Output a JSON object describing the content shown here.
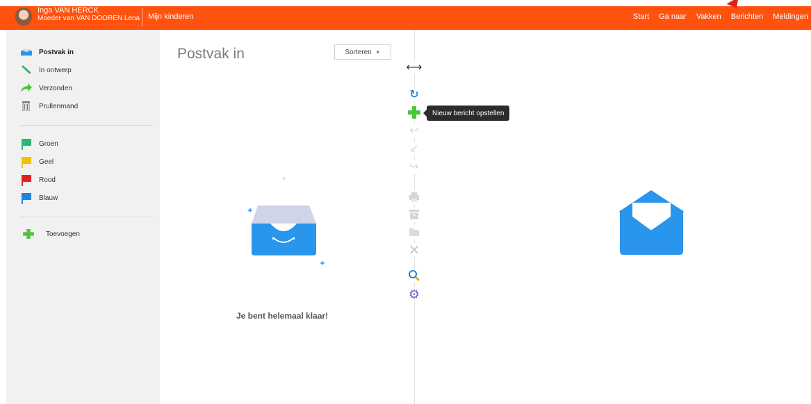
{
  "header": {
    "user_name": "Inga VAN HERCK",
    "user_sub": "Moeder van VAN DOOREN Lena",
    "kids_link": "Mijn kinderen",
    "nav": [
      "Start",
      "Ga naar",
      "Vakken",
      "Berichten",
      "Meldingen"
    ],
    "brand_color": "#ff520e"
  },
  "sidebar": {
    "folders": [
      {
        "label": "Postvak in",
        "icon": "inbox-icon",
        "active": true
      },
      {
        "label": "In ontwerp",
        "icon": "pencil-icon",
        "active": false
      },
      {
        "label": "Verzonden",
        "icon": "sent-arrow-icon",
        "active": false
      },
      {
        "label": "Prullenmand",
        "icon": "trash-icon",
        "active": false
      }
    ],
    "flags": [
      {
        "label": "Groen",
        "color": "#2bb673"
      },
      {
        "label": "Geel",
        "color": "#f2c200"
      },
      {
        "label": "Rood",
        "color": "#e3211c"
      },
      {
        "label": "Blauw",
        "color": "#1f86e0"
      }
    ],
    "add_label": "Toevoegen"
  },
  "list": {
    "title": "Postvak in",
    "sort_label": "Sorteren",
    "empty_message": "Je bent helemaal klaar!"
  },
  "toolbar": {
    "tooltip": "Nieuw bericht opstellen",
    "tools": [
      "resize-icon",
      "refresh-icon",
      "compose-plus-icon",
      "reply-icon",
      "reply-all-icon",
      "forward-icon",
      "print-icon",
      "archive-icon",
      "move-folder-icon",
      "delete-icon",
      "search-icon",
      "settings-gear-icon"
    ]
  }
}
